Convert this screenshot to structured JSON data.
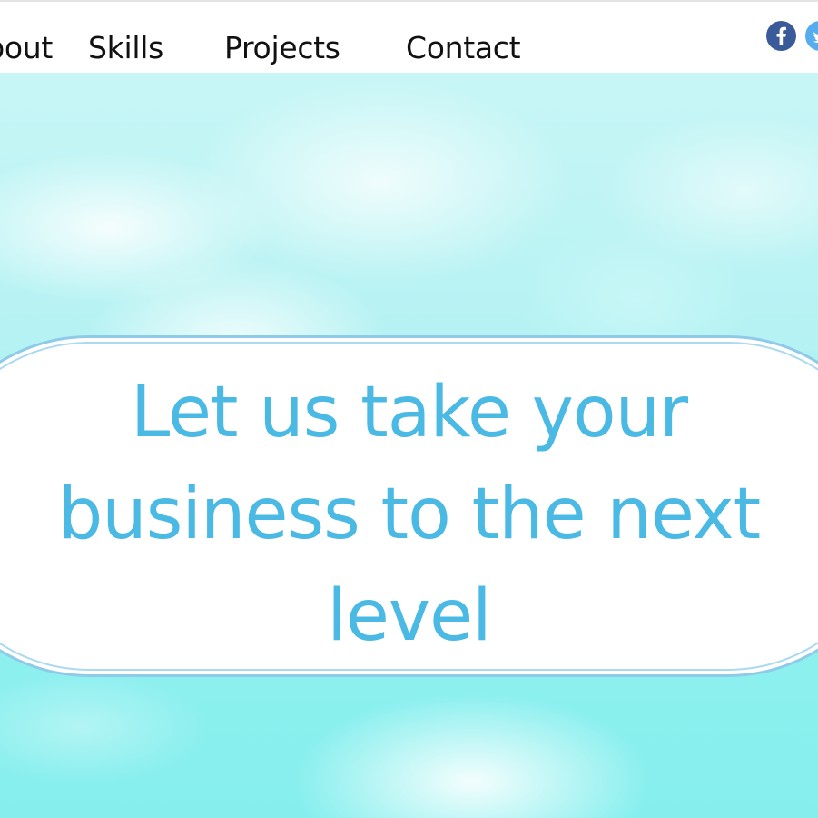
{
  "nav": {
    "items": [
      {
        "label": "About"
      },
      {
        "label": "Skills"
      },
      {
        "label": "Projects"
      },
      {
        "label": "Contact"
      }
    ]
  },
  "social": {
    "facebook": {
      "icon": "facebook-icon",
      "color": "#3b5a9a"
    },
    "twitter": {
      "icon": "twitter-icon",
      "color": "#55acee"
    }
  },
  "hero": {
    "headline": "Let us take your business to the next level",
    "headline_color": "#4ab9e4",
    "sky_color": "#86efee"
  }
}
